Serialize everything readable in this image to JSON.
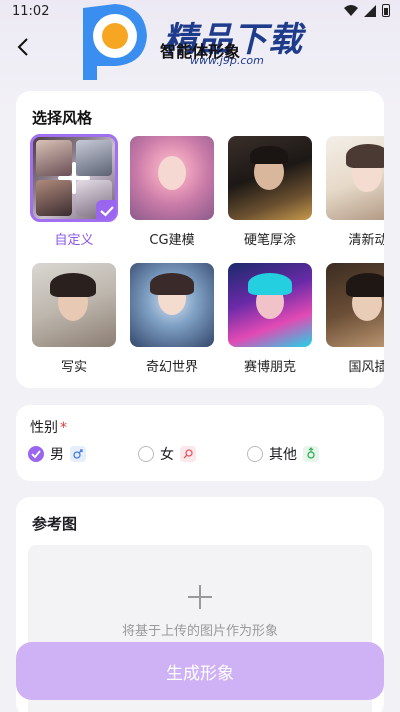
{
  "status_bar": {
    "time": "11:02"
  },
  "header": {
    "title": "智能体形象"
  },
  "watermark": {
    "text": "精品下载",
    "url": "www.j9p.com"
  },
  "style_section": {
    "title": "选择风格",
    "items": [
      {
        "label": "自定义",
        "selected": true
      },
      {
        "label": "CG建模",
        "selected": false
      },
      {
        "label": "硬笔厚涂",
        "selected": false
      },
      {
        "label": "清新动",
        "selected": false
      },
      {
        "label": "写实",
        "selected": false
      },
      {
        "label": "奇幻世界",
        "selected": false
      },
      {
        "label": "赛博朋克",
        "selected": false
      },
      {
        "label": "国风插",
        "selected": false
      }
    ]
  },
  "gender_section": {
    "title": "性别",
    "required_mark": "*",
    "options": [
      {
        "label": "男",
        "selected": true,
        "icon": "male-icon"
      },
      {
        "label": "女",
        "selected": false,
        "icon": "female-icon"
      },
      {
        "label": "其他",
        "selected": false,
        "icon": "other-gender-icon"
      }
    ]
  },
  "reference_section": {
    "title": "参考图",
    "upload_hint": "将基于上传的图片作为形象"
  },
  "generate_button": {
    "label": "生成形象"
  },
  "colors": {
    "accent": "#9a66ef",
    "button": "#cfb2f6"
  }
}
